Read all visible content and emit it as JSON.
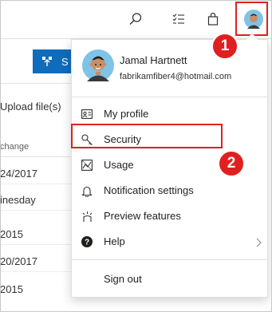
{
  "background": {
    "action_button_label": "S",
    "upload_text": "Upload file(s)",
    "column_header": "change",
    "dates": [
      "24/2017",
      "inesday",
      "2015",
      "20/2017",
      "2015"
    ]
  },
  "topbar": {
    "icons": [
      "search-icon",
      "task-list-icon",
      "shopping-bag-icon",
      "user-avatar"
    ]
  },
  "profile": {
    "name": "Jamal Hartnett",
    "email": "fabrikamfiber4@hotmail.com"
  },
  "menu": {
    "items": [
      {
        "label": "My profile",
        "icon": "contact-card-icon"
      },
      {
        "label": "Security",
        "icon": "key-icon"
      },
      {
        "label": "Usage",
        "icon": "usage-icon"
      },
      {
        "label": "Notification settings",
        "icon": "bell-icon"
      },
      {
        "label": "Preview features",
        "icon": "preview-features-icon"
      },
      {
        "label": "Help",
        "icon": "help-icon"
      }
    ],
    "sign_out": "Sign out"
  },
  "callouts": {
    "badge_1": "1",
    "badge_2": "2",
    "color": "#e02020"
  },
  "colors": {
    "accent_blue": "#0f6cbd",
    "callout_red": "#e02020"
  }
}
